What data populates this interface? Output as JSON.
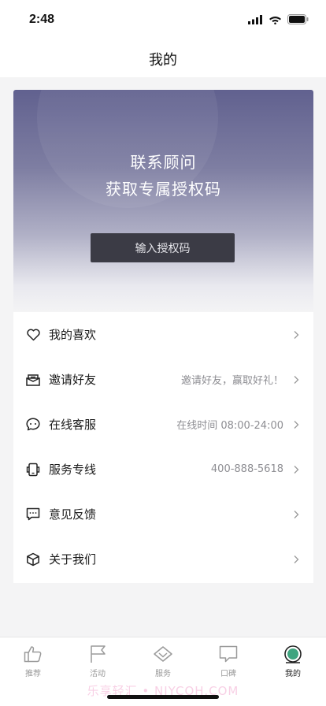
{
  "status_bar": {
    "time": "2:48"
  },
  "header": {
    "title": "我的"
  },
  "auth_card": {
    "line1": "联系顾问",
    "line2": "获取专属授权码",
    "button_label": "输入授权码"
  },
  "menu": {
    "items": [
      {
        "label": "我的喜欢",
        "value": "",
        "icon": "heart-icon"
      },
      {
        "label": "邀请好友",
        "value": "邀请好友，赢取好礼！",
        "icon": "gift-box-icon"
      },
      {
        "label": "在线客服",
        "value": "在线时间 08:00-24:00",
        "icon": "chat-bubble-icon"
      },
      {
        "label": "服务专线",
        "value": "400-888-5618",
        "icon": "phone-icon"
      },
      {
        "label": "意见反馈",
        "value": "",
        "icon": "feedback-icon"
      },
      {
        "label": "关于我们",
        "value": "",
        "icon": "cube-icon"
      }
    ]
  },
  "tab_bar": {
    "tabs": [
      {
        "label": "推荐",
        "icon": "thumbs-up-icon",
        "active": false
      },
      {
        "label": "活动",
        "icon": "flag-icon",
        "active": false
      },
      {
        "label": "服务",
        "icon": "diamond-icon",
        "active": false
      },
      {
        "label": "口碑",
        "icon": "comment-icon",
        "active": false
      },
      {
        "label": "我的",
        "icon": "profile-circle-icon",
        "active": true
      }
    ]
  },
  "watermark": "乐享轻汇 • NJYCOH.COM",
  "colors": {
    "accent": "#2e8b6a",
    "card_top": "#61618f",
    "button_bg": "#3b3b45"
  }
}
